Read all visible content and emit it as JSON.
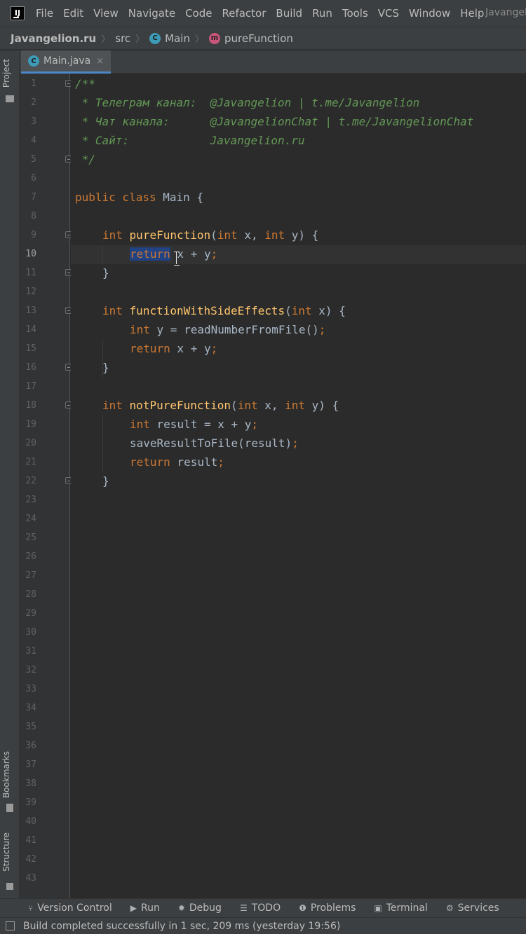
{
  "menubar": {
    "logo": "IJ",
    "items": [
      "File",
      "Edit",
      "View",
      "Navigate",
      "Code",
      "Refactor",
      "Build",
      "Run",
      "Tools",
      "VCS",
      "Window",
      "Help"
    ],
    "window_title": "Javangelion"
  },
  "breadcrumb": {
    "project": "Javangelion.ru",
    "folder": "src",
    "class_badge": "C",
    "class_name": "Main",
    "method_badge": "m",
    "method_name": "pureFunction"
  },
  "side_tabs": {
    "project": "Project",
    "bookmarks": "Bookmarks",
    "structure": "Structure"
  },
  "editor": {
    "tab": {
      "badge": "C",
      "label": "Main.java",
      "close": "×"
    },
    "line_count": 43,
    "current_line": 10,
    "code": {
      "l1": "/**",
      "l2": " * Телеграм канал:  @Javangelion | t.me/Javangelion",
      "l3": " * Чат канала:      @JavangelionChat | t.me/JavangelionChat",
      "l4": " * Сайт:            Javangelion.ru",
      "l5": " */",
      "l7_kw": "public class",
      "l7_name": "Main",
      "l7_brace": " {",
      "l9_kw": "int",
      "l9_fn": "pureFunction",
      "l9_p1": "(",
      "l9_t1": "int",
      "l9_p2": " x, ",
      "l9_t2": "int",
      "l9_p3": " y) {",
      "l10_sel": "return",
      "l10_rest": " x + y",
      "l10_semi": ";",
      "l11": "}",
      "l13_kw": "int",
      "l13_fn": "functionWithSideEffects",
      "l13_p1": "(",
      "l13_t1": "int",
      "l13_p2": " x) {",
      "l14_kw": "int",
      "l14_rest": " y = readNumberFromFile()",
      "l14_semi": ";",
      "l15_kw": "return",
      "l15_rest": " x + y",
      "l15_semi": ";",
      "l16": "}",
      "l18_kw": "int",
      "l18_fn": "notPureFunction",
      "l18_p1": "(",
      "l18_t1": "int",
      "l18_p2": " x, ",
      "l18_t2": "int",
      "l18_p3": " y) {",
      "l19_kw": "int",
      "l19_rest": " result = x + y",
      "l19_semi": ";",
      "l20_rest": "saveResultToFile(result)",
      "l20_semi": ";",
      "l21_kw": "return",
      "l21_rest": " result",
      "l21_semi": ";",
      "l22": "}"
    }
  },
  "tool_tabs": [
    {
      "icon": "version-control-icon",
      "label": "Version Control"
    },
    {
      "icon": "run-icon",
      "label": "Run"
    },
    {
      "icon": "debug-icon",
      "label": "Debug"
    },
    {
      "icon": "todo-icon",
      "label": "TODO"
    },
    {
      "icon": "problems-icon",
      "label": "Problems"
    },
    {
      "icon": "terminal-icon",
      "label": "Terminal"
    },
    {
      "icon": "services-icon",
      "label": "Services"
    }
  ],
  "status": {
    "text": "Build completed successfully in 1 sec, 209 ms (yesterday 19:56)"
  },
  "colors": {
    "background": "#2b2b2b",
    "keyword": "#cc7832",
    "doc_comment": "#629755",
    "function_name": "#ffc66d",
    "identifier": "#a9b7c6",
    "selection": "#214283",
    "accent": "#4a88c7"
  }
}
